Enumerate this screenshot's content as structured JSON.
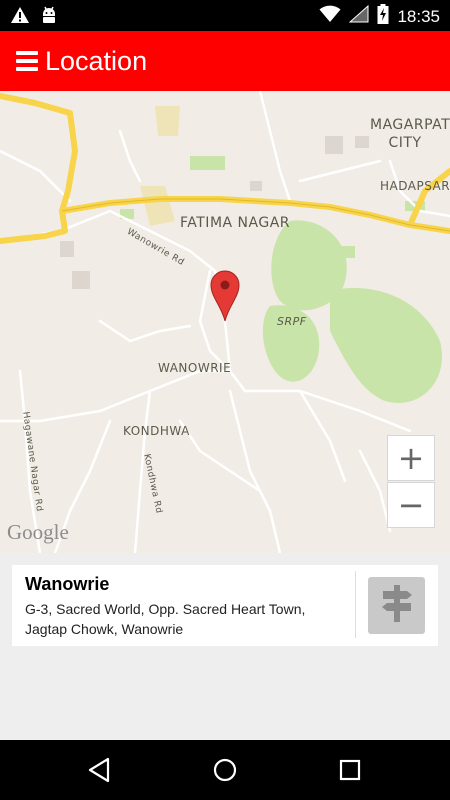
{
  "status_bar": {
    "time": "18:35",
    "icons": [
      "warning-icon",
      "android-debug-icon",
      "wifi-icon",
      "signal-icon",
      "battery-charging-icon"
    ]
  },
  "app_bar": {
    "title": "Location",
    "menu_icon": "hamburger-menu-icon"
  },
  "map": {
    "labels": {
      "magarpatta_city": "MAGARPATTA CITY",
      "hadapsar": "HADAPSAR",
      "fatima_nagar": "FATIMA NAGAR",
      "wanowrie_rd": "Wanowrie Rd",
      "srpf": "SRPF",
      "wanowrie": "WANOWRIE",
      "kondhwa": "KONDHWA",
      "hagawane_nagar_rd": "Hagawane Nagar Rd",
      "kondhwa_rd": "Kondhwa Rd"
    },
    "zoom_in_label": "+",
    "zoom_out_label": "−",
    "attribution": "Google",
    "colors": {
      "land": "#f2ece6",
      "park": "#c8e4a8",
      "highway": "#f7d44a",
      "road": "#ffffff",
      "marker": "#e53935"
    }
  },
  "location_card": {
    "title": "Wanowrie",
    "address": "G-3, Sacred World, Opp. Sacred Heart Town, Jagtap Chowk, Wanowrie",
    "directions_icon": "signpost-directions-icon"
  },
  "nav_bar": {
    "buttons": [
      "back-icon",
      "home-icon",
      "recents-icon"
    ]
  }
}
